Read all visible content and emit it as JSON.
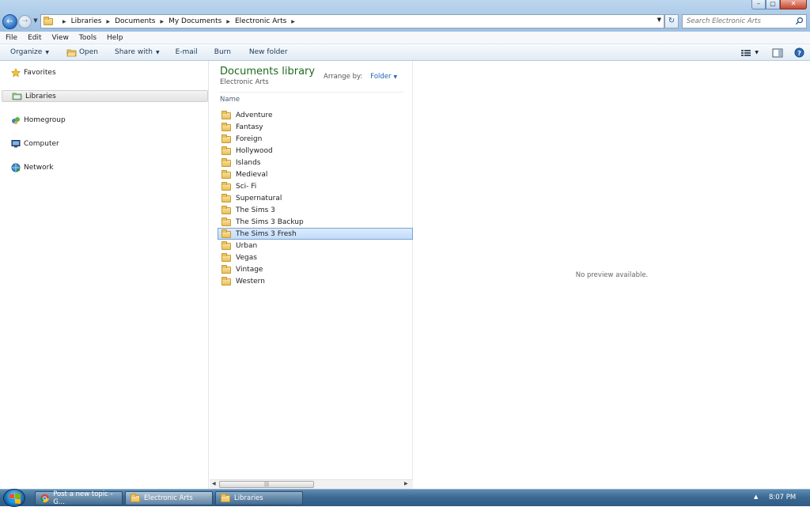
{
  "window": {
    "caption_buttons": {
      "minimize": "–",
      "maximize": "▢",
      "close": "✕"
    },
    "back_icon": "back-arrow-icon",
    "forward_icon": "forward-arrow-icon"
  },
  "address": {
    "crumbs": [
      "Libraries",
      "Documents",
      "My Documents",
      "Electronic Arts"
    ]
  },
  "search": {
    "placeholder": "Search Electronic Arts"
  },
  "menu": [
    "File",
    "Edit",
    "View",
    "Tools",
    "Help"
  ],
  "toolbar": {
    "organize": "Organize",
    "open": "Open",
    "share_with": "Share with",
    "email": "E-mail",
    "burn": "Burn",
    "new_folder": "New folder"
  },
  "nav": {
    "favorites": "Favorites",
    "libraries": "Libraries",
    "homegroup": "Homegroup",
    "computer": "Computer",
    "network": "Network"
  },
  "library": {
    "title": "Documents library",
    "subtitle": "Electronic Arts",
    "arrange_label": "Arrange by:",
    "arrange_value": "Folder",
    "column_name": "Name"
  },
  "files": [
    {
      "name": "Adventure"
    },
    {
      "name": "Fantasy"
    },
    {
      "name": "Foreign"
    },
    {
      "name": "Hollywood"
    },
    {
      "name": "Islands"
    },
    {
      "name": "Medieval"
    },
    {
      "name": "Sci- Fi"
    },
    {
      "name": "Supernatural"
    },
    {
      "name": "The Sims 3"
    },
    {
      "name": "The Sims 3 Backup"
    },
    {
      "name": "The Sims 3 Fresh",
      "selected": true
    },
    {
      "name": "Urban"
    },
    {
      "name": "Vegas"
    },
    {
      "name": "Vintage"
    },
    {
      "name": "Western"
    }
  ],
  "preview": {
    "message": "No preview available."
  },
  "taskbar": {
    "items": [
      "Post a new topic - G...",
      "Electronic Arts",
      "Libraries"
    ],
    "clock": "8:07 PM"
  },
  "colors": {
    "accent_green": "#1e6a1e",
    "link_blue": "#1e64b4",
    "selection": "#c1dcfc"
  }
}
